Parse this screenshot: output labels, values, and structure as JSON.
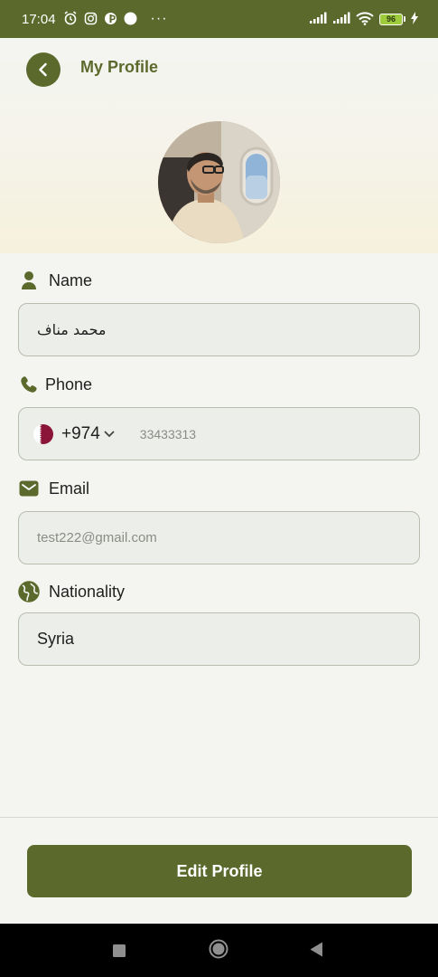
{
  "status_bar": {
    "time": "17:04",
    "battery_level": "96",
    "icons": [
      "alarm-icon",
      "instagram-icon",
      "app-icon",
      "circle-icon",
      "more-dots-icon",
      "signal-icon",
      "signal-icon",
      "wifi-icon",
      "battery-icon",
      "charging-icon"
    ],
    "more": "···"
  },
  "header": {
    "title": "My Profile"
  },
  "fields": {
    "name": {
      "label": "Name",
      "value": "محمد مناف"
    },
    "phone": {
      "label": "Phone",
      "country_code": "+974",
      "value": "33433313"
    },
    "email": {
      "label": "Email",
      "value": "test222@gmail.com"
    },
    "nationality": {
      "label": "Nationality",
      "value": "Syria"
    }
  },
  "actions": {
    "edit_profile": "Edit Profile"
  },
  "colors": {
    "primary": "#5b6a2c",
    "background": "#f4f4f1",
    "input_bg": "#eceeea",
    "input_border": "#b8bdb0"
  }
}
